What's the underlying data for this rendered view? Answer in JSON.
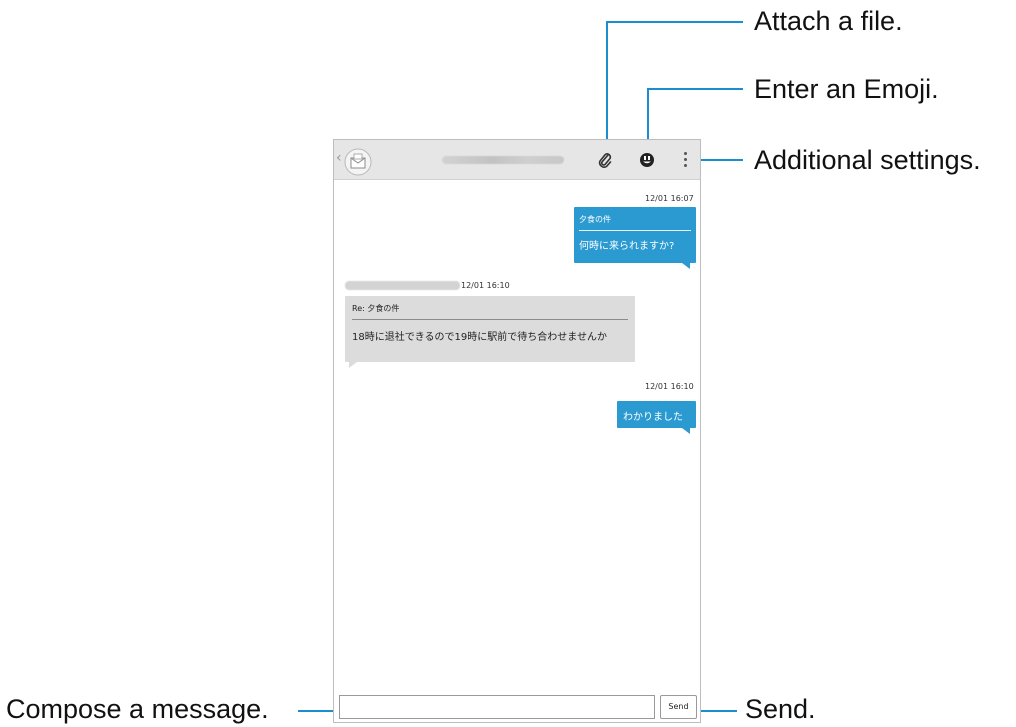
{
  "callouts": {
    "attach": "Attach a file.",
    "emoji": "Enter an Emoji.",
    "settings": "Additional settings.",
    "compose": "Compose a message.",
    "send": "Send."
  },
  "messages": {
    "out1": {
      "time": "12/01 16:07",
      "subject": "夕食の件",
      "body": "何時に来られますか?"
    },
    "in1": {
      "time": "12/01 16:10",
      "subject": "Re: 夕食の件",
      "body": "18時に退社できるので19時に駅前で待ち合わせませんか"
    },
    "out2": {
      "time": "12/01 16:10",
      "body": "わかりました"
    }
  },
  "composer": {
    "send_label": "Send"
  },
  "colors": {
    "accent": "#1a8ecf",
    "outgoing_bubble": "#2b9ad1",
    "incoming_bubble": "#dcdcdc",
    "topbar": "#e6e6e6"
  }
}
